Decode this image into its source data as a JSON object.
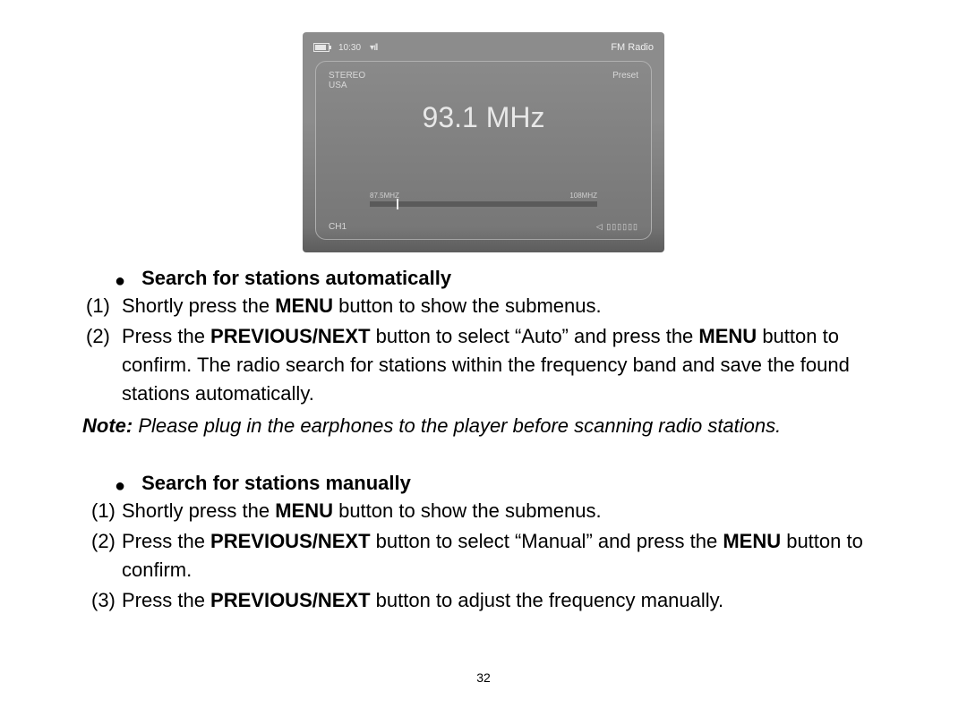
{
  "radio": {
    "time": "10:30",
    "signal": "▾ıll",
    "title": "FM Radio",
    "stereo": "STEREO",
    "region": "USA",
    "preset": "Preset",
    "frequency": "93.1 MHz",
    "dial_min": "87.5MHZ",
    "dial_max": "108MHZ",
    "channel": "CH1",
    "volume": "◁ ▯▯▯▯▯▯"
  },
  "sec1": {
    "title": "Search for stations automatically",
    "items": [
      {
        "n": "(1)",
        "pre": "Shortly press the ",
        "b1": "MENU",
        "post": " button to show the submenus."
      },
      {
        "n": "(2)",
        "pre": "Press the ",
        "b1": "PREVIOUS/NEXT",
        "mid": " button to select “Auto” and press the ",
        "b2": "MENU",
        "post": " button to confirm. The radio search for stations within the frequency band and save the found stations automatically."
      }
    ],
    "note_label": "Note:",
    "note_body": " Please plug in the earphones to the player before scanning radio stations."
  },
  "sec2": {
    "title": "Search for stations manually",
    "items": [
      {
        "n": "(1)",
        "pre": "Shortly press the ",
        "b1": "MENU",
        "post": " button to show the submenus."
      },
      {
        "n": "(2)",
        "pre": "Press the ",
        "b1": "PREVIOUS/NEXT",
        "mid": " button to select “Manual” and press the ",
        "b2": "MENU",
        "post": " button to confirm."
      },
      {
        "n": "(3)",
        "pre": "Press the ",
        "b1": "PREVIOUS/NEXT",
        "post": " button to adjust the frequency manually."
      }
    ]
  },
  "page_number": "32"
}
